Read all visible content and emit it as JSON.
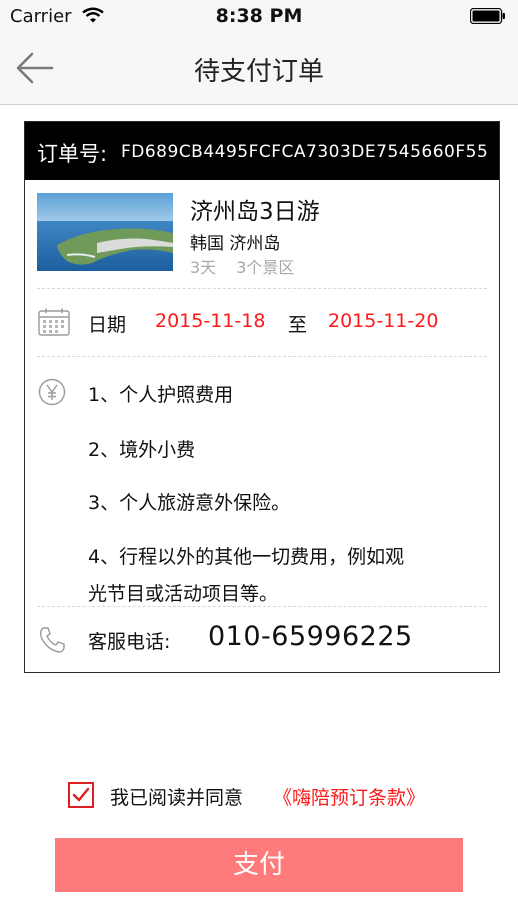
{
  "status_bar": {
    "carrier": "Carrier",
    "time": "8:38 PM"
  },
  "nav": {
    "title": "待支付订单"
  },
  "order": {
    "label": "订单号:",
    "number": "FD689CB4495FCFCA7303DE7545660F55"
  },
  "trip": {
    "title": "济州岛3日游",
    "location": "韩国 济州岛",
    "days": "3天",
    "spots": "3个景区"
  },
  "date": {
    "label": "日期",
    "start": "2015-11-18",
    "separator": "至",
    "end": "2015-11-20"
  },
  "fees": {
    "items": [
      "1、个人护照费用",
      "2、境外小费",
      "3、个人旅游意外保险。",
      "4、行程以外的其他一切费用，例如观"
    ],
    "item4_cont": "光节目或活动项目等。"
  },
  "service": {
    "label": "客服电话:",
    "phone": "010-65996225"
  },
  "agreement": {
    "text": "我已阅读并同意",
    "link": "《嗨陪预订条款》",
    "checked": true
  },
  "pay": {
    "label": "支付"
  },
  "colors": {
    "accent_red": "#ff1a1a",
    "pay_button": "#ff7a7a",
    "header_black": "#000000"
  }
}
